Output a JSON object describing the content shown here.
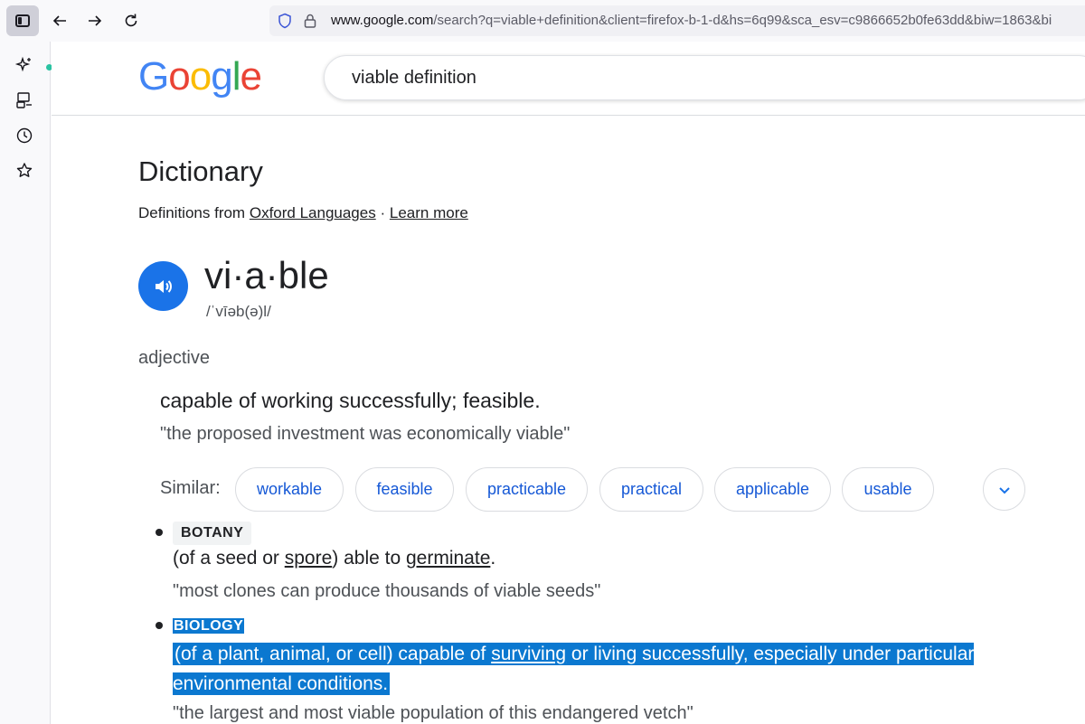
{
  "browser": {
    "url_host": "www.google.com",
    "url_rest": "/search?q=viable+definition&client=firefox-b-1-d&hs=6q99&sca_esv=c9866652b0fe63dd&biw=1863&bi"
  },
  "google": {
    "logo_letters": [
      "G",
      "o",
      "o",
      "g",
      "l",
      "e"
    ],
    "search_value": "viable definition"
  },
  "dictionary": {
    "title": "Dictionary",
    "source_prefix": "Definitions from",
    "source_link": "Oxford Languages",
    "separator": "·",
    "learn_more": "Learn more",
    "word": "vi·a·ble",
    "phonetic": "/ˈvīəb(ə)l/",
    "part_of_speech": "adjective",
    "definition_1": "capable of working successfully; feasible.",
    "example_1": "\"the proposed investment was economically viable\"",
    "similar_label": "Similar:",
    "similar": [
      "workable",
      "feasible",
      "practicable",
      "practical",
      "applicable",
      "usable"
    ],
    "sense_botany": {
      "tag": "BOTANY",
      "def_a": "(of a seed or ",
      "link_1": "spore",
      "def_b": ") able to ",
      "link_2": "germinate",
      "def_c": ".",
      "example": "\"most clones can produce thousands of viable seeds\""
    },
    "sense_biology": {
      "tag": "BIOLOGY",
      "def_a": "(of a plant, animal, or cell) capable of ",
      "link": "surviving",
      "def_b": " or living successfully, especially under particular environmental conditions.",
      "example": "\"the largest and most viable population of this endangered vetch\""
    }
  },
  "colors": {
    "accent": "#1a73e8",
    "selection": "#0b78d0",
    "chip_text": "#1558d6"
  }
}
